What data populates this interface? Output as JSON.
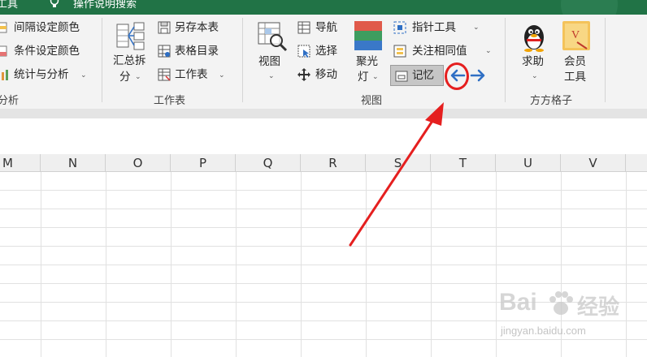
{
  "titlebar": {
    "left_text": "工具",
    "search_text": "操作说明搜索"
  },
  "ribbon": {
    "partial_group": {
      "items": [
        {
          "label": "间隔设定颜色",
          "icon": "interval-color-icon"
        },
        {
          "label": "条件设定颜色",
          "icon": "condition-color-icon"
        },
        {
          "label": "统计与分析",
          "icon": "statistics-icon"
        }
      ],
      "group_label": "分析"
    },
    "worksheet_group": {
      "big_button_line1": "汇总拆",
      "big_button_line2": "分",
      "items": [
        {
          "label": "另存本表",
          "icon": "save-sheet-icon"
        },
        {
          "label": "表格目录",
          "icon": "sheet-catalog-icon"
        },
        {
          "label": "工作表",
          "icon": "worksheet-icon"
        }
      ],
      "group_label": "工作表"
    },
    "view_group": {
      "view_button": "视图",
      "items": [
        {
          "label": "导航",
          "icon": "navigation-icon"
        },
        {
          "label": "选择",
          "icon": "select-icon"
        },
        {
          "label": "移动",
          "icon": "move-icon"
        }
      ],
      "spotlight_line1": "聚光",
      "spotlight_line2": "灯",
      "pointer_tool": "指针工具",
      "focus_same": "关注相同值",
      "memory": "记忆",
      "group_label": "视图"
    },
    "fangfang_group": {
      "help": "求助",
      "member_line1": "会员",
      "member_line2": "工具",
      "group_label": "方方格子"
    }
  },
  "columns": [
    "M",
    "N",
    "O",
    "P",
    "Q",
    "R",
    "S",
    "T",
    "U",
    "V"
  ],
  "watermark": {
    "brand": "Bai",
    "brand2": "经验",
    "sub": "jingyan.baidu.com"
  },
  "colors": {
    "excel_green": "#217346",
    "annotation_red": "#e51f1f",
    "nav_arrow_blue": "#2f6fc4"
  }
}
